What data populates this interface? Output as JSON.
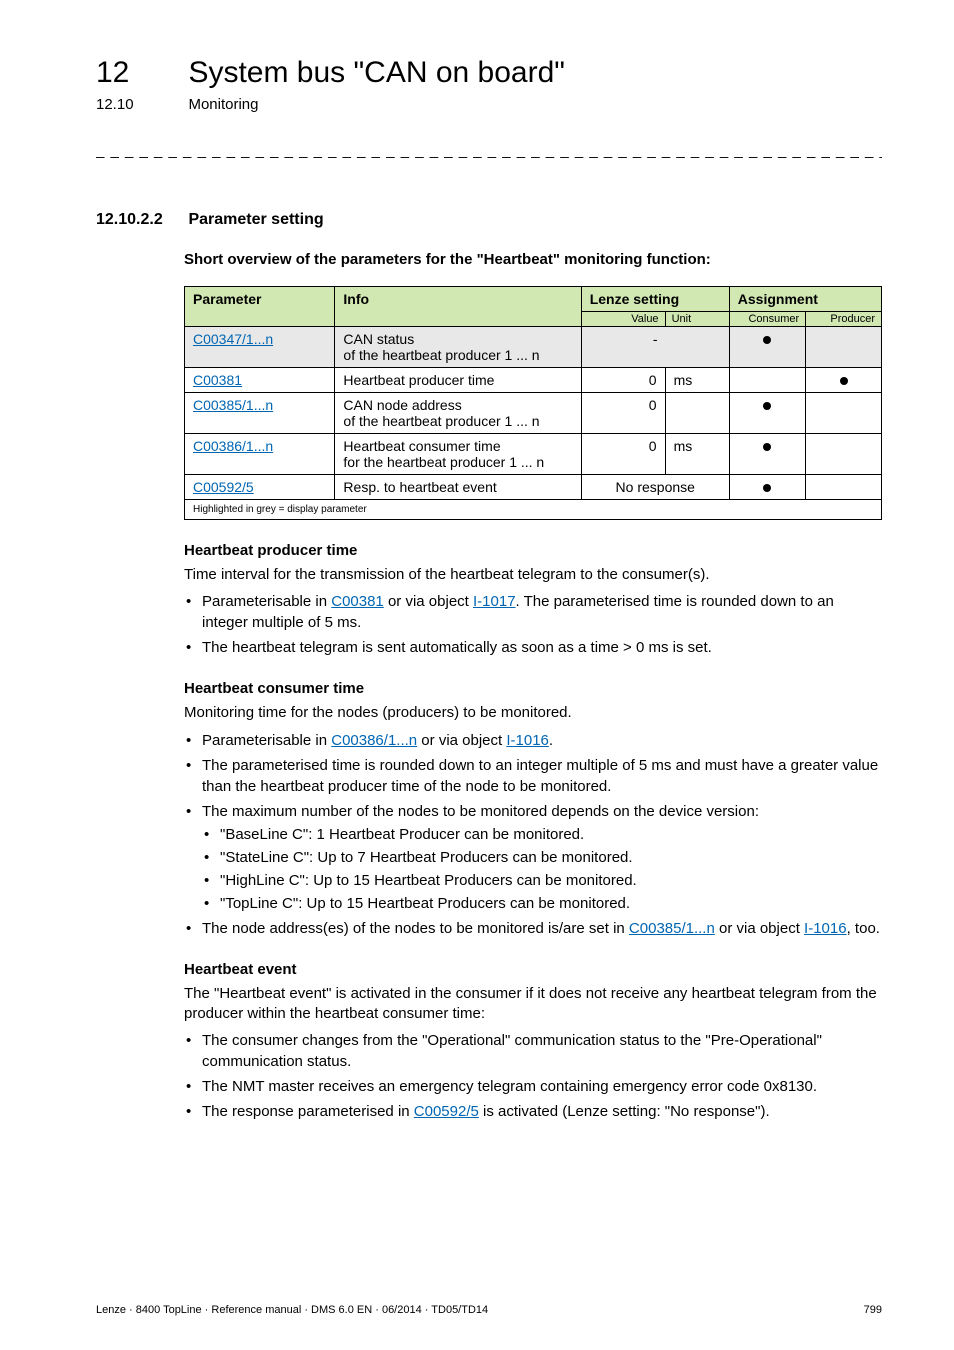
{
  "header": {
    "chapter_num": "12",
    "chapter_title": "System bus \"CAN on board\"",
    "sub_num": "12.10",
    "sub_title": "Monitoring",
    "dashes": "_ _ _ _ _ _ _ _ _ _ _ _ _ _ _ _ _ _ _ _ _ _ _ _ _ _ _ _ _ _ _ _ _ _ _ _ _ _ _ _ _ _ _ _ _ _ _ _ _ _ _ _ _ _ _ _ _ _ _ _ _ _ _ _"
  },
  "section": {
    "num": "12.10.2.2",
    "title": "Parameter setting",
    "overview": "Short overview of the parameters for the \"Heartbeat\" monitoring function:"
  },
  "table": {
    "headers": {
      "parameter": "Parameter",
      "info": "Info",
      "lenze": "Lenze setting",
      "assignment": "Assignment",
      "value": "Value",
      "unit": "Unit",
      "consumer": "Consumer",
      "producer": "Producer"
    },
    "rows": [
      {
        "param_link": "C00347/1...n",
        "info_l1": "CAN status",
        "info_l2": "of the heartbeat producer 1 ... n",
        "value": "-",
        "unit": "",
        "consumer_dot": true,
        "producer_dot": false,
        "gray": true
      },
      {
        "param_link": "C00381",
        "info_l1": "Heartbeat producer time",
        "info_l2": "",
        "value": "0",
        "unit": "ms",
        "consumer_dot": false,
        "producer_dot": true,
        "gray": false
      },
      {
        "param_link": "C00385/1...n",
        "info_l1": "CAN node address",
        "info_l2": "of the heartbeat producer 1 ... n",
        "value": "0",
        "unit": "",
        "consumer_dot": true,
        "producer_dot": false,
        "gray": false
      },
      {
        "param_link": "C00386/1...n",
        "info_l1": "Heartbeat consumer time",
        "info_l2": "for the heartbeat producer 1 ... n",
        "value": "0",
        "unit": "ms",
        "consumer_dot": true,
        "producer_dot": false,
        "gray": false
      },
      {
        "param_link": "C00592/5",
        "info_l1": "Resp. to heartbeat event",
        "info_l2": "",
        "value_span": "No response",
        "consumer_dot": true,
        "producer_dot": false,
        "gray": false
      }
    ],
    "footnote": "Highlighted in grey = display parameter"
  },
  "hpt": {
    "title": "Heartbeat producer time",
    "intro": "Time interval for the transmission of the heartbeat telegram to the consumer(s).",
    "b1_pre": "Parameterisable in ",
    "b1_link1": "C00381",
    "b1_mid": " or via object ",
    "b1_link2": "I-1017",
    "b1_post": ". The parameterised time is rounded down to an integer multiple of 5 ms.",
    "b2": "The heartbeat telegram is sent automatically as soon as a time > 0 ms is set."
  },
  "hct": {
    "title": "Heartbeat consumer time",
    "intro": "Monitoring time for the nodes (producers) to be monitored.",
    "b1_pre": "Parameterisable in ",
    "b1_link1": "C00386/1...n",
    "b1_mid": " or via object ",
    "b1_link2": "I-1016",
    "b1_post": ".",
    "b2": "The parameterised time is rounded down to an integer multiple of 5 ms and must have a greater value than the heartbeat producer time of the node to be monitored.",
    "b3": "The maximum number of the nodes to be monitored depends on the device version:",
    "b3s1": "\"BaseLine C\": 1 Heartbeat Producer can be monitored.",
    "b3s2": "\"StateLine C\": Up to 7 Heartbeat Producers can be monitored.",
    "b3s3": "\"HighLine C\": Up to 15 Heartbeat Producers can be monitored.",
    "b3s4": "\"TopLine C\": Up to 15 Heartbeat Producers can be monitored.",
    "b4_pre": "The node address(es) of the nodes to be monitored is/are set in ",
    "b4_link1": "C00385/1...n",
    "b4_mid": " or via object ",
    "b4_link2": "I-1016",
    "b4_post": ", too."
  },
  "he": {
    "title": "Heartbeat event",
    "intro": "The \"Heartbeat event\" is activated in the consumer if it does not receive any heartbeat telegram from the producer within the heartbeat consumer time:",
    "b1": "The consumer changes from the \"Operational\" communication status to the \"Pre-Operational\" communication status.",
    "b2": "The NMT master receives an emergency telegram containing emergency error code 0x8130.",
    "b3_pre": "The response parameterised in ",
    "b3_link": "C00592/5",
    "b3_post": " is activated (Lenze setting: \"No response\")."
  },
  "footer": {
    "left": "Lenze · 8400 TopLine · Reference manual · DMS 6.0 EN · 06/2014 · TD05/TD14",
    "right": "799"
  }
}
